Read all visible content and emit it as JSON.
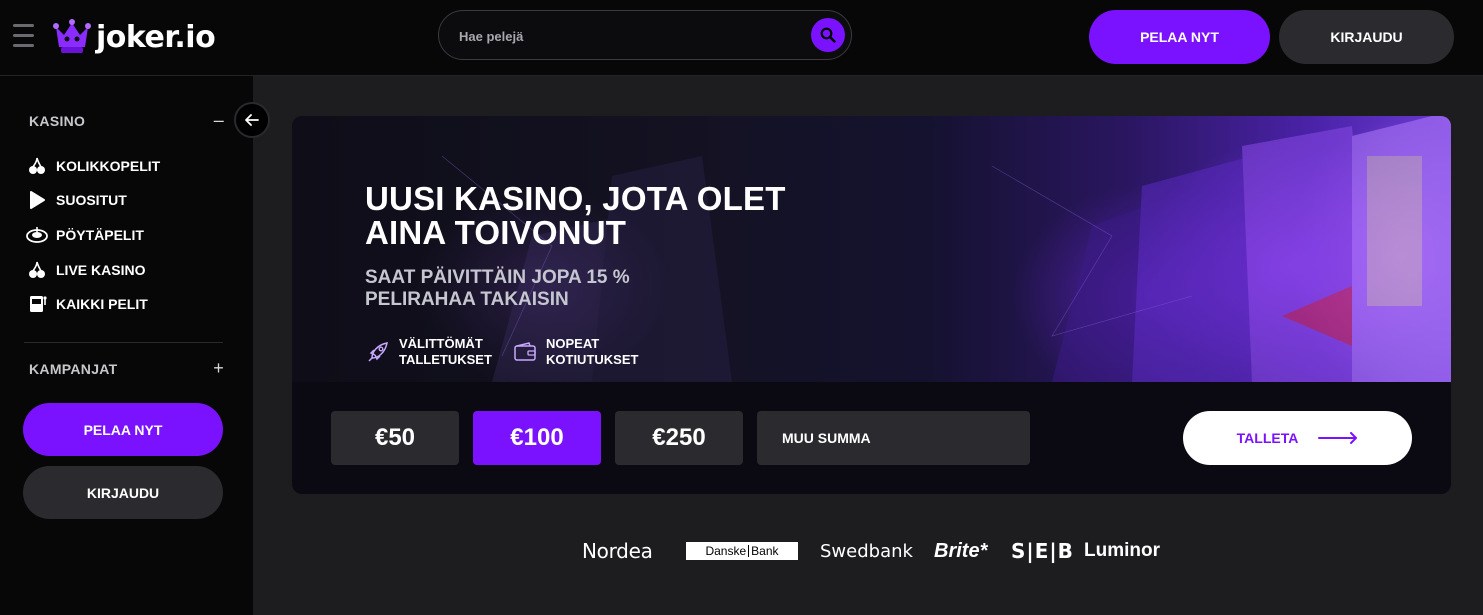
{
  "header": {
    "logo_text": "joker.io",
    "search_placeholder": "Hae pelejä",
    "play_label": "PELAA NYT",
    "login_label": "KIRJAUDU"
  },
  "sidebar": {
    "casino_heading": "KASINO",
    "casino_toggle": "–",
    "items": [
      {
        "label": "KOLIKKOPELIT",
        "icon": "cherries-icon"
      },
      {
        "label": "SUOSITUT",
        "icon": "play-icon"
      },
      {
        "label": "PÖYTÄPELIT",
        "icon": "roulette-icon"
      },
      {
        "label": "LIVE KASINO",
        "icon": "cherries-icon"
      },
      {
        "label": "KAIKKI PELIT",
        "icon": "slot-machine-icon"
      }
    ],
    "campaigns_heading": "KAMPANJAT",
    "campaigns_toggle": "+",
    "play_label": "PELAA NYT",
    "login_label": "KIRJAUDU"
  },
  "banner": {
    "title": "UUSI KASINO, JOTA OLET AINA TOIVONUT",
    "subtitle": "SAAT PÄIVITTÄIN JOPA 15 % PELIRAHAA TAKAISIN",
    "features": [
      {
        "label": "VÄLITTÖMÄT TALLETUKSET",
        "icon": "rocket-icon"
      },
      {
        "label": "NOPEAT KOTIUTUKSET",
        "icon": "wallet-icon"
      }
    ],
    "amounts": [
      "€50",
      "€100",
      "€250"
    ],
    "selected_amount": "€100",
    "custom_placeholder": "MUU SUMMA",
    "deposit_label": "TALLETA"
  },
  "banks": {
    "nordea": "Nordea",
    "danske_left": "Danske",
    "danske_right": "Bank",
    "swedbank": "Swedbank",
    "brite": "Brite*",
    "seb": "S|E|B",
    "luminor": "Luminor"
  },
  "colors": {
    "accent": "#7b12ff",
    "background": "#1d1d20",
    "panel": "#070708",
    "button_dark": "#2b2b2f"
  }
}
